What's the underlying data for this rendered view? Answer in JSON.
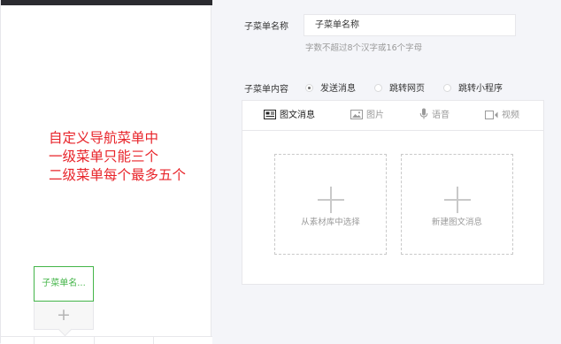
{
  "preview": {
    "annotation_lines": [
      "自定义导航菜单中",
      "一级菜单只能三个",
      "二级菜单每个最多五个"
    ],
    "submenu_item_label": "子菜单名...",
    "add_label": "+"
  },
  "editor": {
    "name_label": "子菜单名称",
    "name_value": "子菜单名称",
    "name_hint": "字数不超过8个汉字或16个字母",
    "content_label": "子菜单内容",
    "content_options": [
      {
        "label": "发送消息",
        "selected": true
      },
      {
        "label": "跳转网页",
        "selected": false
      },
      {
        "label": "跳转小程序",
        "selected": false
      }
    ],
    "tabs": [
      {
        "label": "图文消息",
        "icon": "news-icon",
        "active": true
      },
      {
        "label": "图片",
        "icon": "image-icon",
        "active": false
      },
      {
        "label": "语音",
        "icon": "microphone-icon",
        "active": false
      },
      {
        "label": "视频",
        "icon": "video-icon",
        "active": false
      }
    ],
    "cards": [
      {
        "label": "从素材库中选择",
        "icon": "plus-icon"
      },
      {
        "label": "新建图文消息",
        "icon": "plus-icon"
      }
    ]
  },
  "colors": {
    "accent_green": "#44b549",
    "annotation_red": "#e8252b",
    "page_background": "#f4f5f9"
  }
}
